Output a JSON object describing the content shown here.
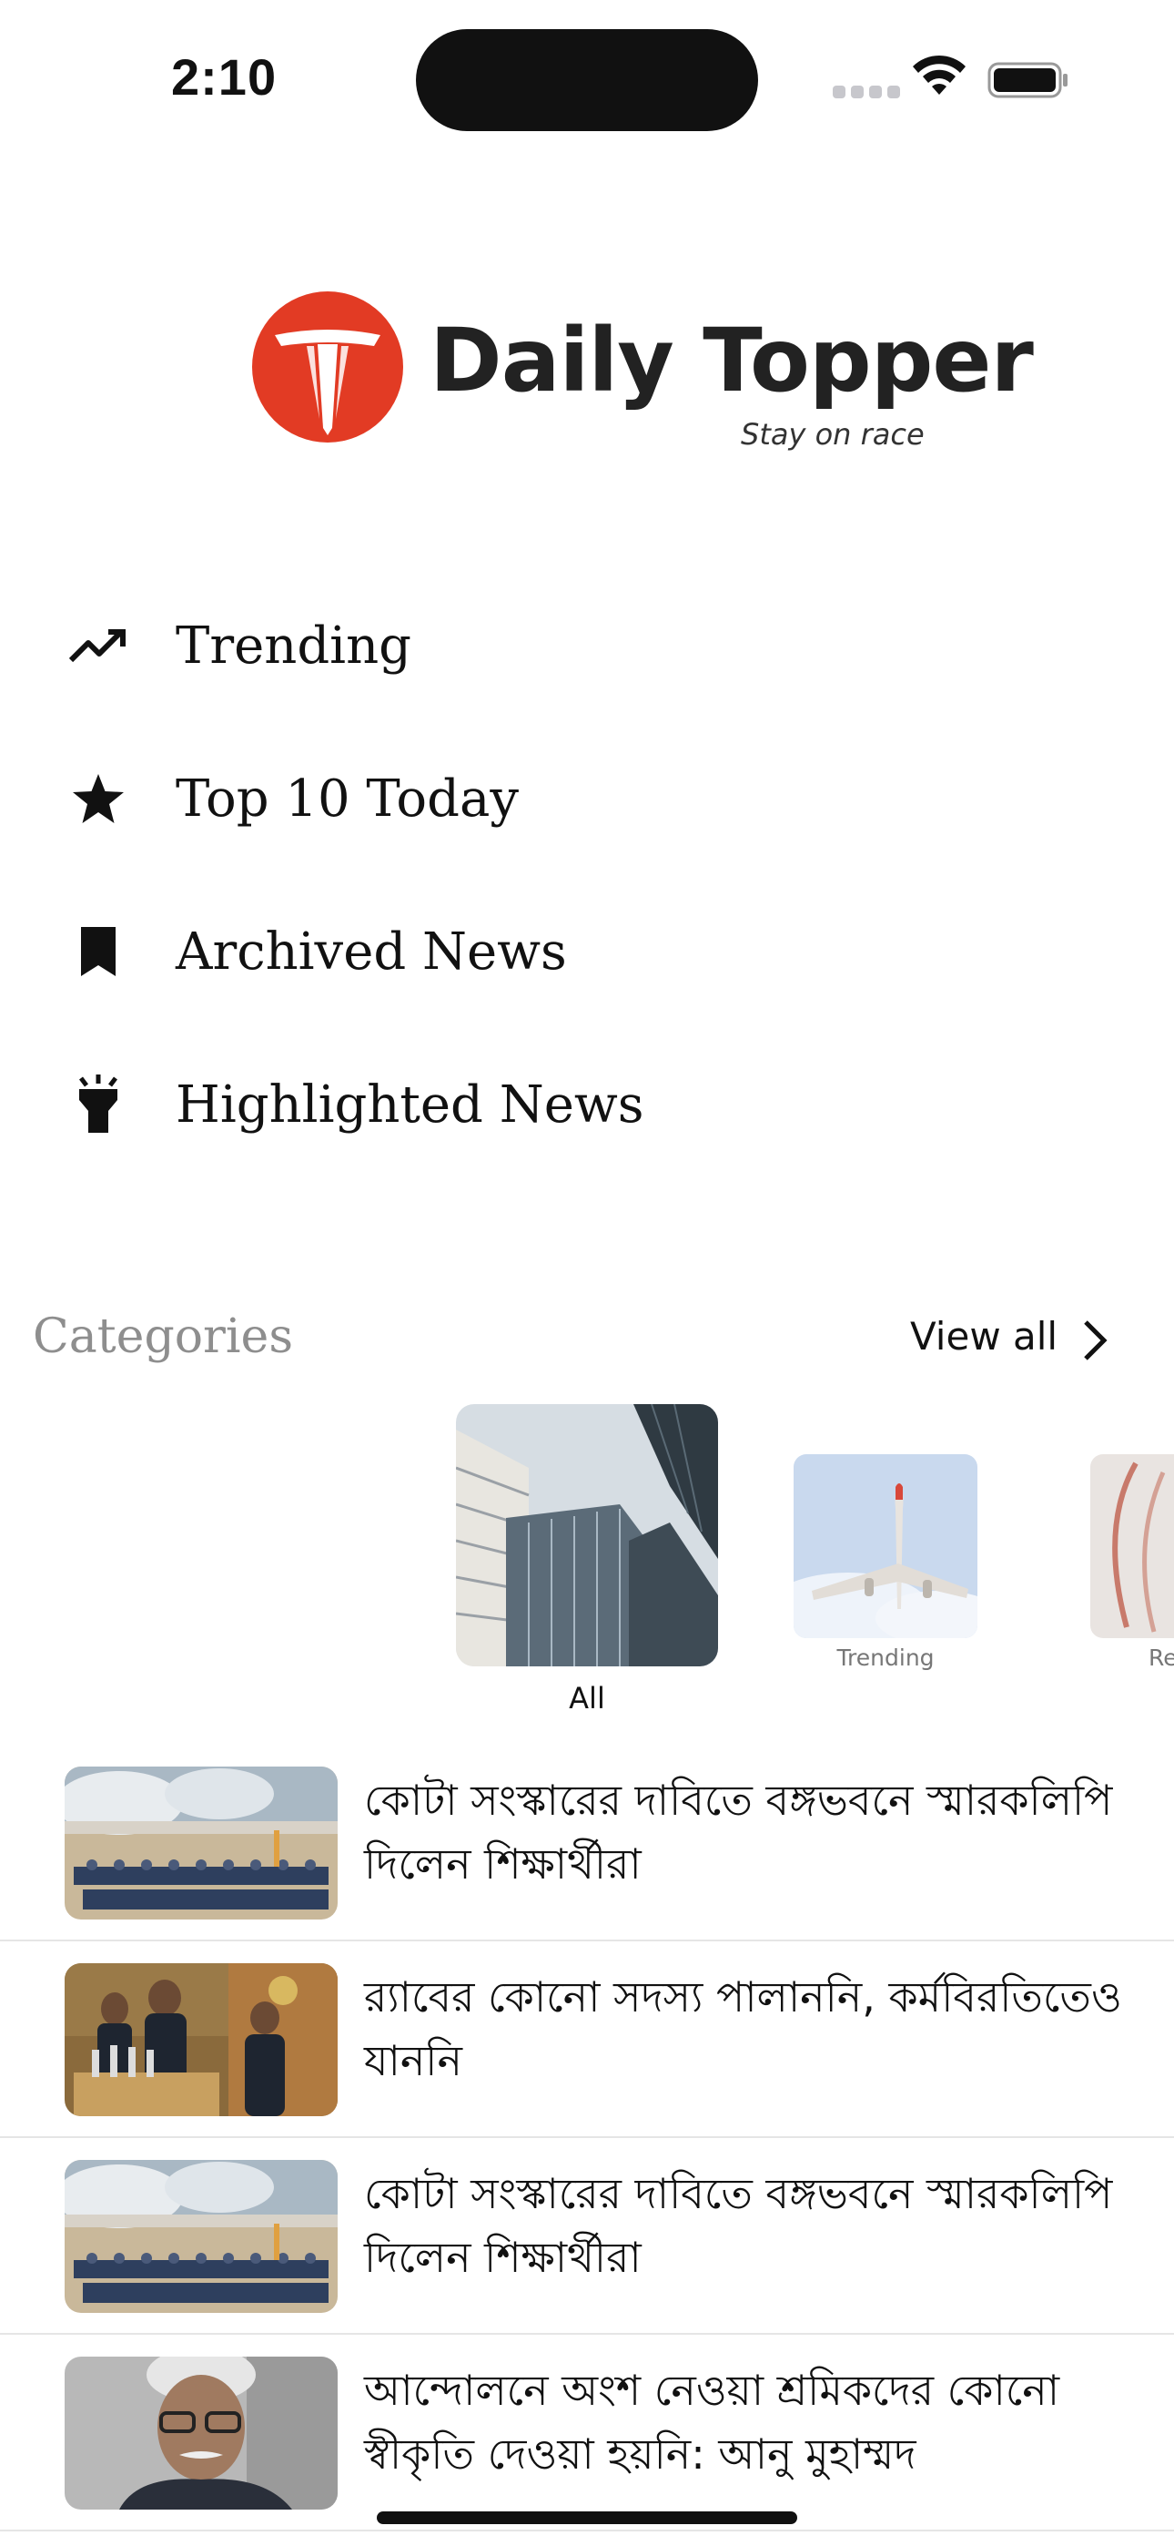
{
  "status_bar": {
    "time": "2:10"
  },
  "brand": {
    "name": "Daily Topper",
    "tagline": "Stay on race",
    "logo_color": "#e23b24"
  },
  "menu": [
    {
      "label": "Trending",
      "icon": "trending-up-icon"
    },
    {
      "label": "Top 10 Today",
      "icon": "star-icon"
    },
    {
      "label": "Archived News",
      "icon": "bookmark-icon"
    },
    {
      "label": "Highlighted News",
      "icon": "flashlight-icon"
    }
  ],
  "categories": {
    "title": "Categories",
    "view_all": "View all",
    "items": [
      {
        "label": "All"
      },
      {
        "label": "Trending"
      },
      {
        "label": "Re"
      }
    ]
  },
  "news": [
    {
      "title": "কোটা সংস্কারের দাবিতে বঙ্গভবনে স্মারকলিপি দিলেন শিক্ষার্থীরা"
    },
    {
      "title": "র‍্যাবের কোনো সদস্য পালাননি, কর্মবিরতিতেও যাননি"
    },
    {
      "title": "কোটা সংস্কারের দাবিতে বঙ্গভবনে স্মারকলিপি দিলেন শিক্ষার্থীরা"
    },
    {
      "title": "আন্দোলনে অংশ নেওয়া শ্রমিকদের কোনো স্বীকৃতি দেওয়া হয়নি: আনু মুহাম্মদ"
    }
  ]
}
